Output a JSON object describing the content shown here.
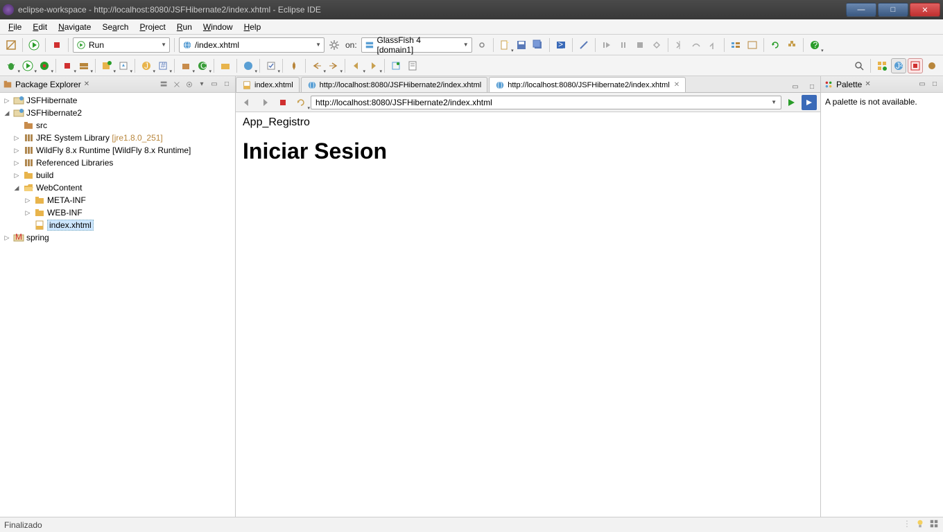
{
  "window": {
    "title": "eclipse-workspace - http://localhost:8080/JSFHibernate2/index.xhtml - Eclipse IDE"
  },
  "menu": [
    "File",
    "Edit",
    "Navigate",
    "Search",
    "Project",
    "Run",
    "Window",
    "Help"
  ],
  "toolbar1": {
    "run_combo": "Run",
    "file_combo": "/index.xhtml",
    "on_label": "on:",
    "server_combo": "GlassFish 4 [domain1]"
  },
  "package_explorer": {
    "title": "Package Explorer",
    "tree": {
      "p1": "JSFHibernate",
      "p2": "JSFHibernate2",
      "src": "src",
      "jre": "JRE System Library",
      "jre_suffix": "[jre1.8.0_251]",
      "wildfly": "WildFly 8.x Runtime [WildFly 8.x Runtime]",
      "reflib": "Referenced Libraries",
      "build": "build",
      "webcontent": "WebContent",
      "metainf": "META-INF",
      "webinf": "WEB-INF",
      "indexfile": "index.xhtml",
      "spring": "spring"
    }
  },
  "editor": {
    "tabs": [
      {
        "label": "index.xhtml",
        "active": false,
        "type": "file"
      },
      {
        "label": "http://localhost:8080/JSFHibernate2/index.xhtml",
        "active": false,
        "type": "web"
      },
      {
        "label": "http://localhost:8080/JSFHibernate2/index.xhtml",
        "active": true,
        "type": "web"
      }
    ],
    "url": "http://localhost:8080/JSFHibernate2/index.xhtml",
    "page": {
      "breadcrumb": "App_Registro",
      "heading": "Iniciar Sesion"
    }
  },
  "palette": {
    "title": "Palette",
    "message": "A palette is not available."
  },
  "status": {
    "text": "Finalizado"
  }
}
